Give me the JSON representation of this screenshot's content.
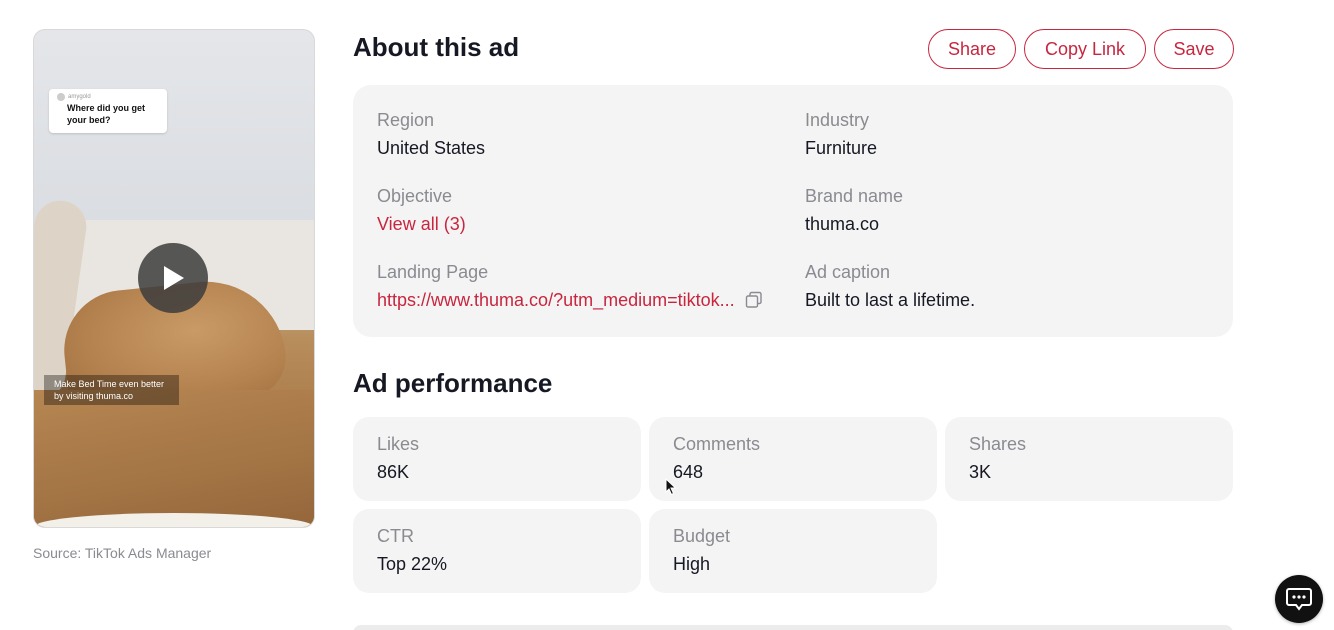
{
  "video": {
    "comment_user": "amygold",
    "comment_question": "Where did you get your bed?",
    "overlay_caption": "Make Bed Time even better by visiting thuma.co",
    "play_icon": "play-icon"
  },
  "source": "Source: TikTok Ads Manager",
  "header": {
    "title": "About this ad",
    "share_label": "Share",
    "copy_link_label": "Copy Link",
    "save_label": "Save"
  },
  "details": {
    "region": {
      "label": "Region",
      "value": "United States"
    },
    "industry": {
      "label": "Industry",
      "value": "Furniture"
    },
    "objective": {
      "label": "Objective",
      "value": "View all (3)"
    },
    "brand": {
      "label": "Brand name",
      "value": "thuma.co"
    },
    "landing": {
      "label": "Landing Page",
      "value": "https://www.thuma.co/?utm_medium=tiktok..."
    },
    "caption": {
      "label": "Ad caption",
      "value": "Built to last a lifetime."
    }
  },
  "performance": {
    "title": "Ad performance",
    "likes": {
      "label": "Likes",
      "value": "86K"
    },
    "comments": {
      "label": "Comments",
      "value": "648"
    },
    "shares": {
      "label": "Shares",
      "value": "3K"
    },
    "ctr": {
      "label": "CTR",
      "value": "Top 22%"
    },
    "budget": {
      "label": "Budget",
      "value": "High"
    }
  },
  "colors": {
    "accent": "#c8263f",
    "card_bg": "#f4f4f4",
    "label": "#8a8b91",
    "text": "#161823"
  }
}
